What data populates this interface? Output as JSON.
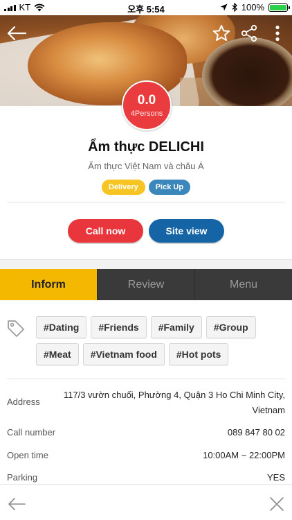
{
  "status_bar": {
    "carrier": "KT",
    "time": "오후 5:54",
    "battery": "100%",
    "battery_level": 1.0,
    "battery_color": "#2bd14a"
  },
  "hero": {
    "icons": [
      "back-arrow-icon",
      "star-icon",
      "share-icon",
      "more-vertical-icon"
    ]
  },
  "rating": {
    "value": "0.0",
    "count": "4Persons",
    "color": "#ea3b3f"
  },
  "restaurant": {
    "name": "Ẩm thực DELICHI",
    "subtitle": "Ẩm thực Việt Nam và châu Á"
  },
  "badges": {
    "delivery": "Delivery",
    "pickup": "Pick Up",
    "delivery_color": "#f6c523",
    "pickup_color": "#3b86ba"
  },
  "actions": {
    "call": "Call now",
    "site": "Site view",
    "call_color": "#e9353c",
    "site_color": "#1565a6"
  },
  "tabs": [
    {
      "label": "Inform",
      "active": true
    },
    {
      "label": "Review",
      "active": false
    },
    {
      "label": "Menu",
      "active": false
    }
  ],
  "tabs_active_color": "#f5b800",
  "tags": {
    "row1": [
      "#Dating",
      "#Friends",
      "#Family",
      "#Group"
    ],
    "row2": [
      "#Meat",
      "#Vietnam food",
      "#Hot pots"
    ]
  },
  "info": {
    "address_label": "Address",
    "address_line1": "117/3 vườn chuối, Phường 4, Quận 3 Ho Chi Minh City,",
    "address_line2": "Vietnam",
    "call_label": "Call number",
    "call_value": "089 847 80 02",
    "open_label": "Open time",
    "open_value": "10:00AM ~ 22:00PM",
    "parking_label": "Parking",
    "parking_value": "YES"
  },
  "bottom_bar": {
    "icons": [
      "back-arrow-icon",
      "close-icon"
    ]
  }
}
